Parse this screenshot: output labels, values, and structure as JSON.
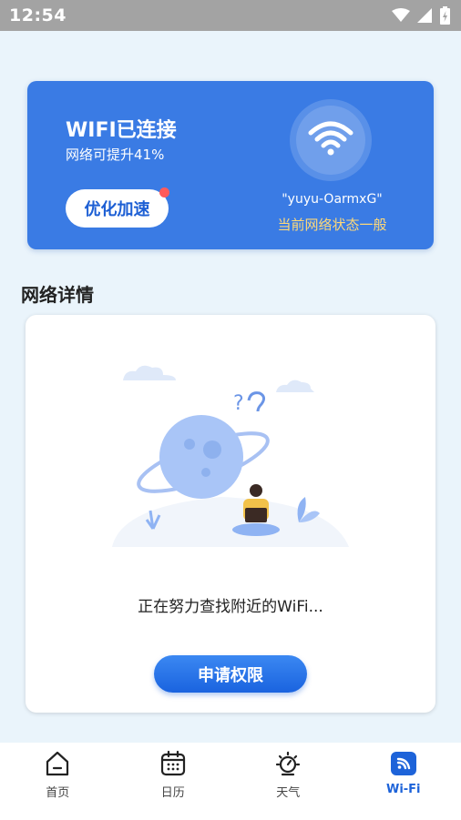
{
  "status_bar": {
    "time": "12:54",
    "icons": [
      "wifi-signal-icon",
      "cell-signal-icon",
      "battery-charging-icon"
    ]
  },
  "wifi_card": {
    "title": "WIFI已连接",
    "subtitle": "网络可提升41%",
    "optimize_button": "优化加速",
    "wifi_icon": "wifi-icon",
    "ssid": "\"yuyu-OarmxG\"",
    "network_state": "当前网络状态一般",
    "colors": {
      "card": "#3a7be4",
      "state_text": "#ffd978",
      "badge": "#ff5b5b"
    }
  },
  "section": {
    "title": "网络详情"
  },
  "detail_card": {
    "illustration": "planet-reading-illustration",
    "search_text": "正在努力查找附近的WiFi...",
    "permission_button": "申请权限"
  },
  "bottom_nav": {
    "items": [
      {
        "label": "首页",
        "icon": "home-icon",
        "active": false
      },
      {
        "label": "日历",
        "icon": "calendar-icon",
        "active": false
      },
      {
        "label": "天气",
        "icon": "weather-icon",
        "active": false
      },
      {
        "label": "Wi-Fi",
        "icon": "wifi-tab-icon",
        "active": true
      }
    ],
    "active_color": "#1d63d9"
  }
}
